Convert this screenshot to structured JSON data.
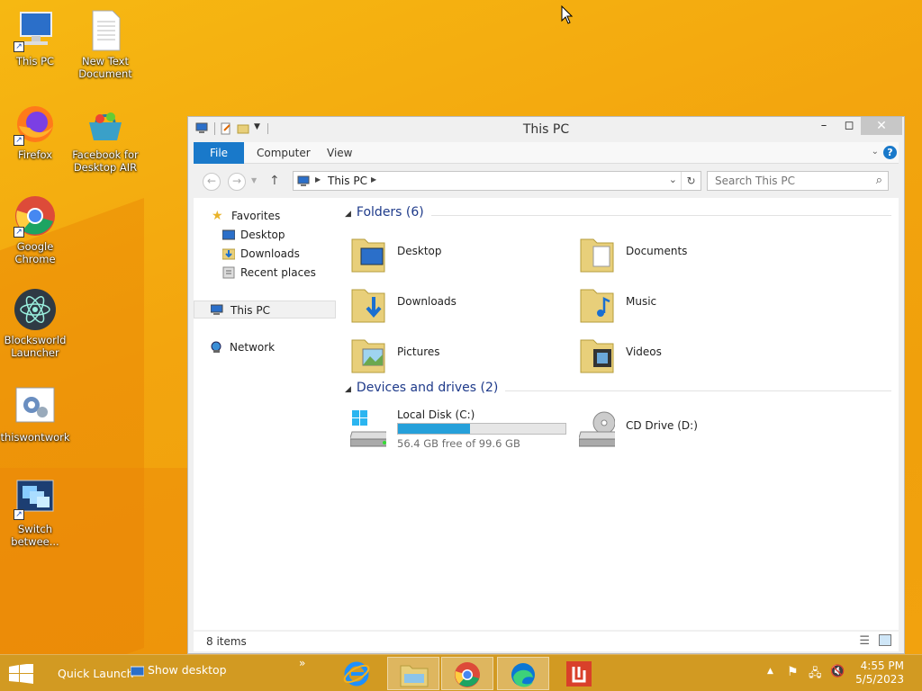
{
  "desktop": {
    "icons": [
      {
        "label": "This PC",
        "icon": "computer-icon"
      },
      {
        "label": "New Text\nDocument",
        "icon": "text-document-icon"
      },
      {
        "label": "Firefox",
        "icon": "firefox-icon"
      },
      {
        "label": "Facebook for\nDesktop AIR",
        "icon": "basket-icon"
      },
      {
        "label": "Google\nChrome",
        "icon": "chrome-icon"
      },
      {
        "label": "Blocksworld\nLauncher",
        "icon": "atom-icon"
      },
      {
        "label": "thiswontwork",
        "icon": "gears-icon"
      },
      {
        "label": "Switch\nbetwee...",
        "icon": "window-switcher-icon"
      }
    ]
  },
  "window": {
    "title": "This PC",
    "ribbon_tabs": [
      "File",
      "Computer",
      "View"
    ],
    "address": "This PC",
    "search_placeholder": "Search This PC",
    "nav": {
      "favorites": "Favorites",
      "desktop": "Desktop",
      "downloads": "Downloads",
      "recent": "Recent places",
      "this_pc": "This PC",
      "network": "Network"
    },
    "folders_header": "Folders (6)",
    "folders": [
      "Desktop",
      "Documents",
      "Downloads",
      "Music",
      "Pictures",
      "Videos"
    ],
    "devices_header": "Devices and drives (2)",
    "drives": [
      {
        "name": "Local Disk (C:)",
        "free": "56.4 GB free of 99.6 GB",
        "used_fraction": 0.43
      },
      {
        "name": "CD Drive (D:)"
      }
    ],
    "status": "8 items"
  },
  "taskbar": {
    "quick_launch": "Quick Launch",
    "show_desktop": "Show desktop",
    "time": "4:55 PM",
    "date": "5/5/2023"
  },
  "colors": {
    "accent": "#1979ca",
    "progress": "#26a0da",
    "folder_header": "#1e3a8a"
  }
}
